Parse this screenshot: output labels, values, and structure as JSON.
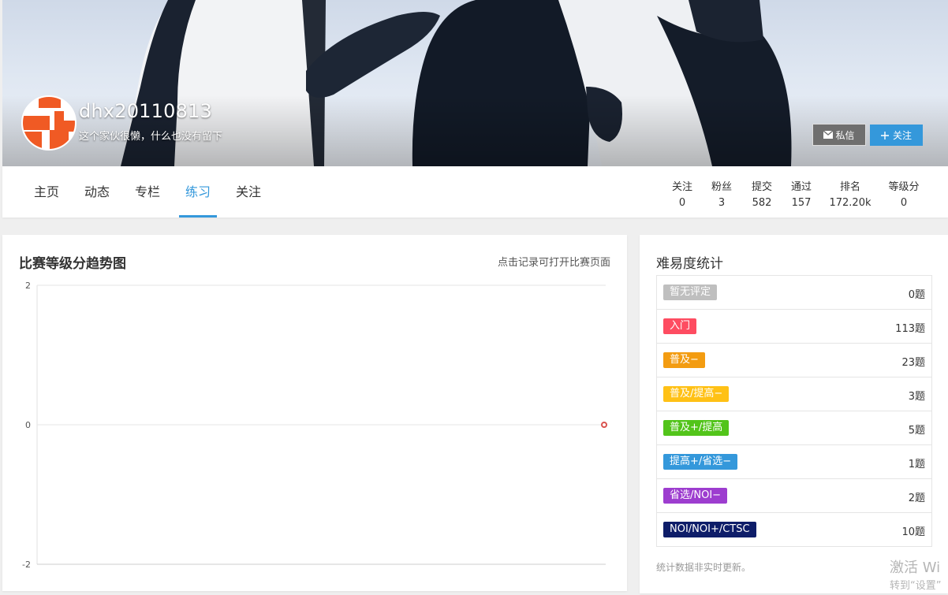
{
  "profile": {
    "username": "dhx20110813",
    "slogan": "这个家伙很懒，什么也没有留下",
    "message_label": "私信",
    "follow_label": "关注"
  },
  "nav": {
    "tabs": [
      {
        "label": "主页"
      },
      {
        "label": "动态"
      },
      {
        "label": "专栏"
      },
      {
        "label": "练习"
      },
      {
        "label": "关注"
      }
    ],
    "active_tab": "练习"
  },
  "stats": [
    {
      "label": "关注",
      "value": "0"
    },
    {
      "label": "粉丝",
      "value": "3"
    },
    {
      "label": "提交",
      "value": "582"
    },
    {
      "label": "通过",
      "value": "157"
    },
    {
      "label": "排名",
      "value": "172.20k"
    },
    {
      "label": "等级分",
      "value": "0"
    }
  ],
  "chart_card": {
    "title": "比赛等级分趋势图",
    "hint": "点击记录可打开比赛页面"
  },
  "chart_data": {
    "type": "line",
    "title": "",
    "xlabel": "",
    "ylabel": "",
    "ylim": [
      -2,
      2
    ],
    "yticks": [
      "2",
      "0",
      "-2"
    ],
    "grid": true,
    "series": [
      {
        "values": [
          0
        ],
        "color": "#d9534f"
      }
    ]
  },
  "difficulty": {
    "title": "难易度统计",
    "rows": [
      {
        "label": "暂无评定",
        "count": "0题",
        "color": "#bfbfbf"
      },
      {
        "label": "入门",
        "count": "113题",
        "color": "#fe4c61"
      },
      {
        "label": "普及−",
        "count": "23题",
        "color": "#f39c11"
      },
      {
        "label": "普及/提高−",
        "count": "3题",
        "color": "#ffc116"
      },
      {
        "label": "普及+/提高",
        "count": "5题",
        "color": "#52c41a"
      },
      {
        "label": "提高+/省选−",
        "count": "1题",
        "color": "#3498db"
      },
      {
        "label": "省选/NOI−",
        "count": "2题",
        "color": "#9d3dcf"
      },
      {
        "label": "NOI/NOI+/CTSC",
        "count": "10题",
        "color": "#0e1d69"
      }
    ],
    "note": "统计数据非实时更新。"
  },
  "watermark": {
    "line1": "激活 Wi",
    "line2": "转到“设置”"
  }
}
